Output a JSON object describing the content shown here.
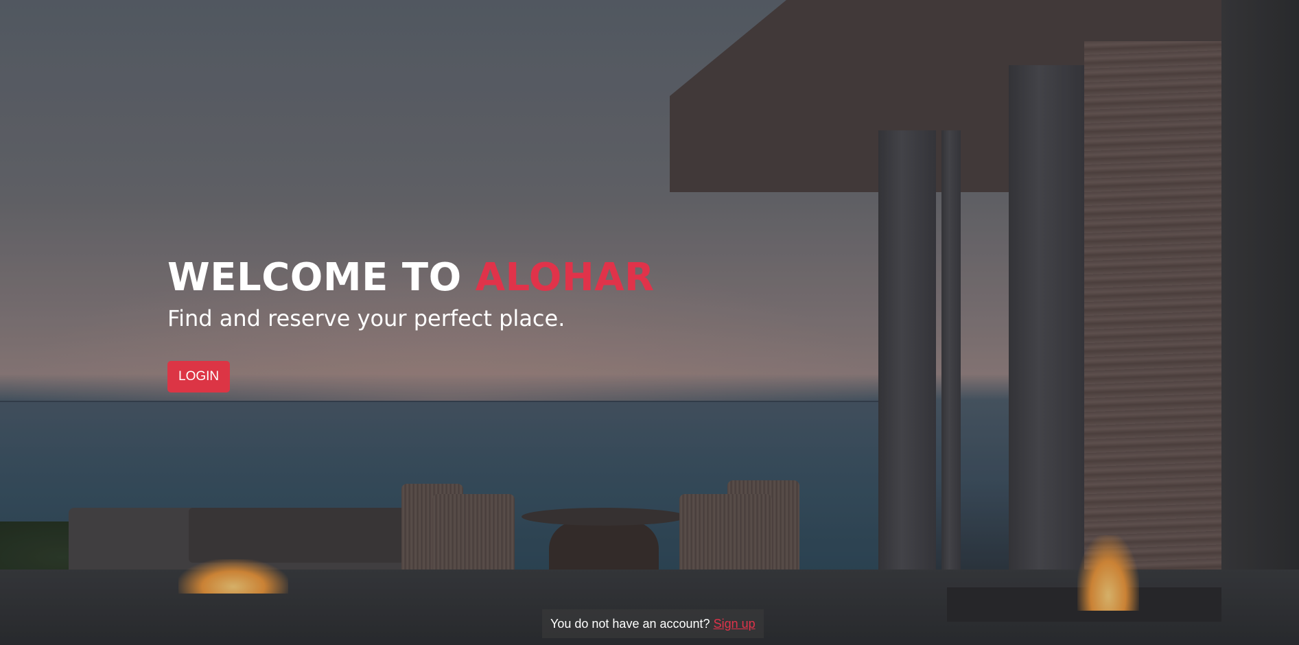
{
  "hero": {
    "title_prefix": "WELCOME TO ",
    "title_brand": "ALOHAR",
    "subtitle": "Find and reserve your perfect place.",
    "login_label": "LOGIN"
  },
  "footer": {
    "prompt": "You do not have an account?",
    "signup_label": "Sign up"
  },
  "colors": {
    "accent": "#dc3545",
    "brand_text": "#e0334a"
  }
}
